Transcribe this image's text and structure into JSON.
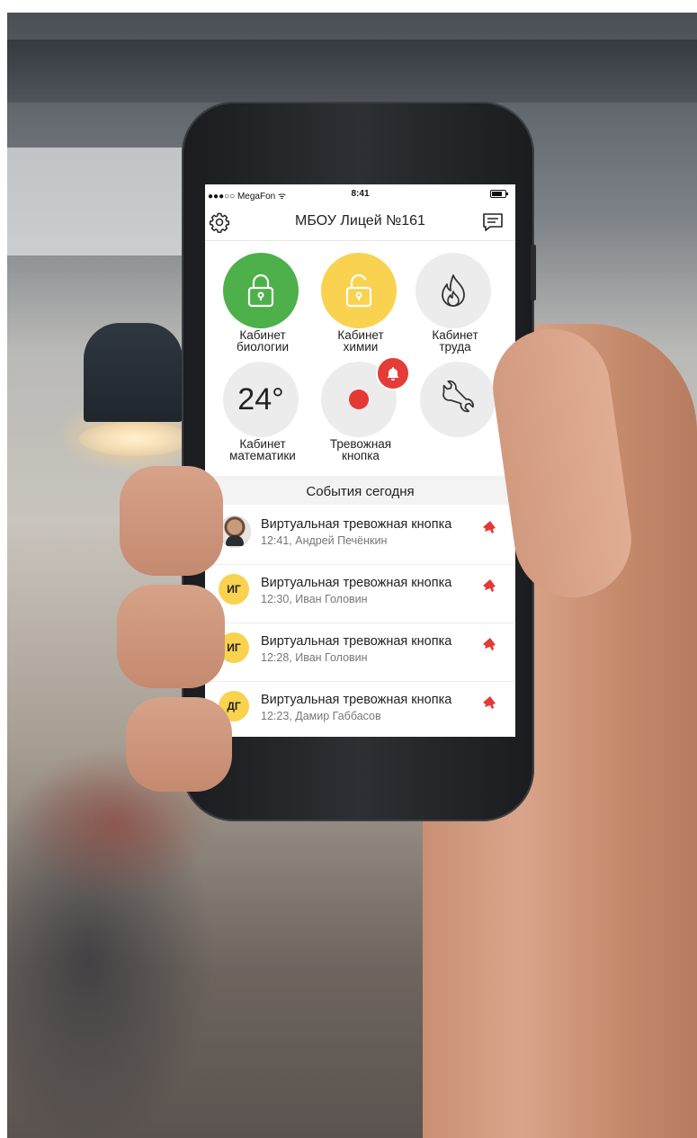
{
  "status_bar": {
    "carrier": "●●●○○ MegaFon ᯤ",
    "time": "8:41"
  },
  "header": {
    "title": "МБОУ Лицей №161"
  },
  "tiles": [
    {
      "label": "Кабинет\nбиологии",
      "state": "locked",
      "color": "#4db04a",
      "icon": "lock-closed-icon"
    },
    {
      "label": "Кабинет\nхимии",
      "state": "unlocked",
      "color": "#f9d24f",
      "icon": "lock-open-icon"
    },
    {
      "label": "Кабинет\nтруда",
      "icon": "fire-icon"
    },
    {
      "label": "Кабинет\nматематики",
      "value": "24°",
      "icon": "temperature"
    },
    {
      "label": "Тревожная\nкнопка",
      "icon": "alarm-button-icon",
      "badge_icon": "bell-icon",
      "badge_color": "#e43c38"
    },
    {
      "label": "",
      "icon": "wrench-icon"
    }
  ],
  "events": {
    "title": "События сегодня",
    "items": [
      {
        "avatar": "",
        "title": "Виртуальная тревожная кнопка",
        "subtitle": "12:41, Андрей Печёнкин"
      },
      {
        "avatar": "ИГ",
        "title": "Виртуальная тревожная кнопка",
        "subtitle": "12:30, Иван Головин"
      },
      {
        "avatar": "ИГ",
        "title": "Виртуальная тревожная кнопка",
        "subtitle": "12:28, Иван Головин"
      },
      {
        "avatar": "ДГ",
        "title": "Виртуальная тревожная кнопка",
        "subtitle": "12:23, Дамир Габбасов"
      }
    ]
  },
  "colors": {
    "accent_red": "#e53935",
    "yellow": "#f9d24f",
    "green": "#4db04a"
  }
}
